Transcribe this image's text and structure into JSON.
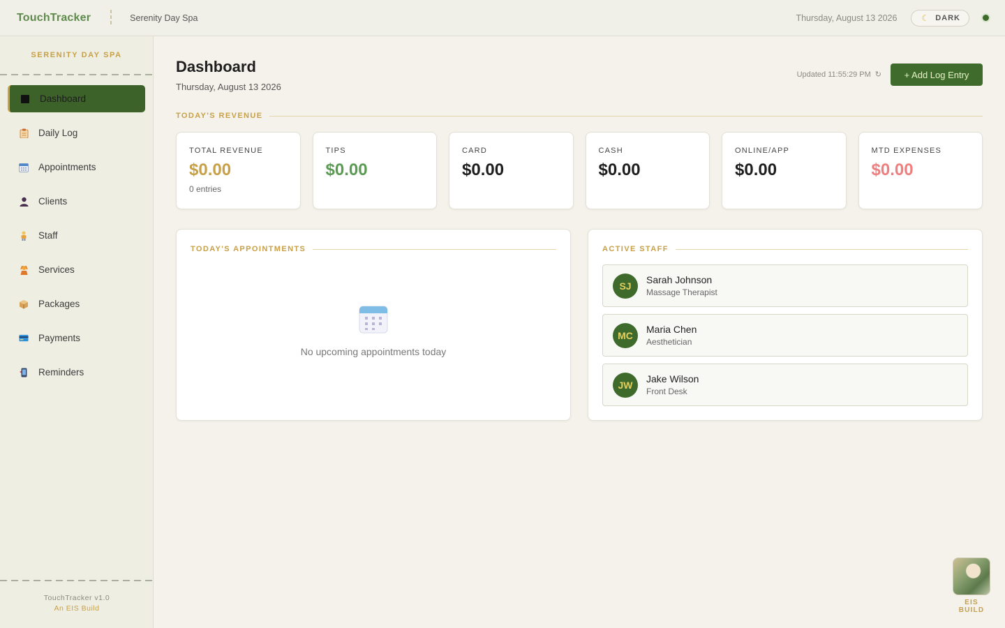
{
  "topbar": {
    "brand": "TouchTracker",
    "business": "Serenity Day Spa",
    "date": "Thursday, August 13 2026",
    "theme_toggle_label": "DARK",
    "theme_toggle_icon": "moon-icon"
  },
  "sidebar": {
    "title": "SERENITY DAY SPA",
    "items": [
      {
        "label": "Dashboard",
        "icon": "dashboard-icon",
        "active": true
      },
      {
        "label": "Daily Log",
        "icon": "clipboard-icon"
      },
      {
        "label": "Appointments",
        "icon": "calendar-icon"
      },
      {
        "label": "Clients",
        "icon": "person-icon"
      },
      {
        "label": "Staff",
        "icon": "staff-icon"
      },
      {
        "label": "Services",
        "icon": "services-icon"
      },
      {
        "label": "Packages",
        "icon": "package-icon"
      },
      {
        "label": "Payments",
        "icon": "credit-card-icon"
      },
      {
        "label": "Reminders",
        "icon": "phone-icon"
      }
    ],
    "footer": {
      "version": "TouchTracker v1.0",
      "build": "An EIS Build"
    }
  },
  "main": {
    "title": "Dashboard",
    "date": "Thursday, August 13 2026",
    "updated": "Updated 11:55:29 PM",
    "add_button": "+ Add Log Entry",
    "revenue_heading": "TODAY'S REVENUE",
    "cards": [
      {
        "label": "TOTAL REVENUE",
        "value": "$0.00",
        "sub": "0 entries",
        "color": "#c8a047"
      },
      {
        "label": "TIPS",
        "value": "$0.00",
        "color": "#5a9a52"
      },
      {
        "label": "CARD",
        "value": "$0.00",
        "color": "#1e1e1e"
      },
      {
        "label": "CASH",
        "value": "$0.00",
        "color": "#1e1e1e"
      },
      {
        "label": "ONLINE/APP",
        "value": "$0.00",
        "color": "#1e1e1e"
      },
      {
        "label": "MTD EXPENSES",
        "value": "$0.00",
        "color": "#ef7e7e"
      }
    ],
    "appointments": {
      "heading": "TODAY'S APPOINTMENTS",
      "empty_text": "No upcoming appointments today"
    },
    "staff": {
      "heading": "ACTIVE STAFF",
      "members": [
        {
          "initials": "SJ",
          "name": "Sarah Johnson",
          "role": "Massage Therapist"
        },
        {
          "initials": "MC",
          "name": "Maria Chen",
          "role": "Aesthetician"
        },
        {
          "initials": "JW",
          "name": "Jake Wilson",
          "role": "Front Desk"
        }
      ]
    }
  },
  "corner": {
    "label": "EIS BUILD"
  },
  "colors": {
    "accent_green": "#3f6b2d",
    "accent_gold": "#c8a047",
    "danger": "#ef7e7e"
  }
}
